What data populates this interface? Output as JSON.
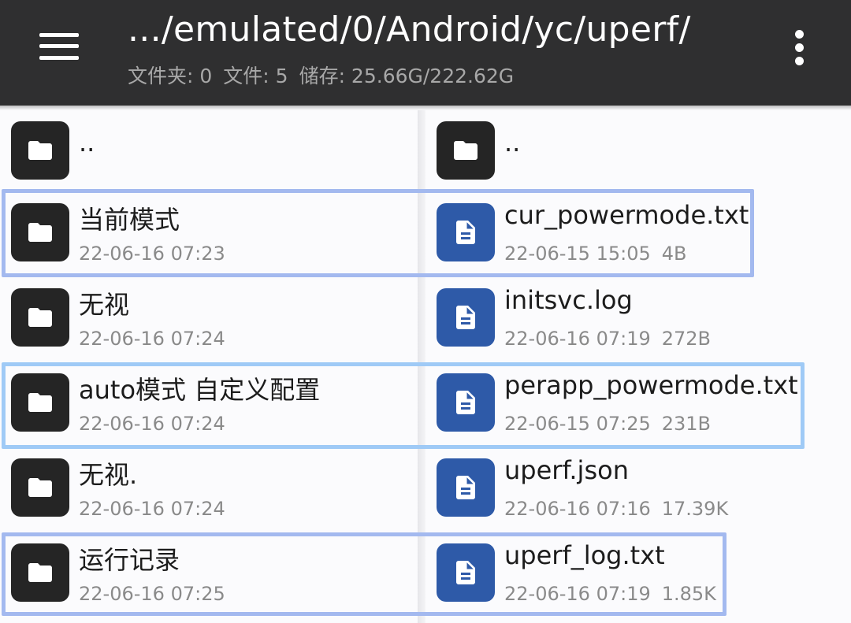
{
  "appbar": {
    "path": ".../emulated/0/Android/yc/uperf/",
    "folders_stat": "文件夹: 0",
    "files_stat": "文件: 5",
    "storage_stat": "储存: 25.66G/222.62G"
  },
  "left_pane": {
    "parent": {
      "name": ".."
    },
    "items": [
      {
        "name": "当前模式",
        "date": "22-06-16 07:23"
      },
      {
        "name": "无视",
        "date": "22-06-16 07:24"
      },
      {
        "name": "auto模式 自定义配置",
        "date": "22-06-16 07:24"
      },
      {
        "name": "无视.",
        "date": "22-06-16 07:24"
      },
      {
        "name": "运行记录",
        "date": "22-06-16 07:25"
      }
    ]
  },
  "right_pane": {
    "parent": {
      "name": ".."
    },
    "items": [
      {
        "name": "cur_powermode.txt",
        "date": "22-06-15 15:05",
        "size": "4B"
      },
      {
        "name": "initsvc.log",
        "date": "22-06-16 07:19",
        "size": "272B"
      },
      {
        "name": "perapp_powermode.txt",
        "date": "22-06-15 07:25",
        "size": "231B"
      },
      {
        "name": "uperf.json",
        "date": "22-06-16 07:16",
        "size": "17.39K"
      },
      {
        "name": "uperf_log.txt",
        "date": "22-06-16 07:19",
        "size": "1.85K"
      }
    ]
  },
  "icons": {
    "menu": "hamburger-menu-icon",
    "more": "more-vert-icon",
    "folder": "folder-icon",
    "file": "document-icon"
  },
  "colors": {
    "appbar_bg": "#2f2f30",
    "file_icon_bg": "#2e5aa8",
    "folder_icon_bg": "#252525",
    "highlight": "#a3b9ef",
    "highlight_light": "#9fcaf6"
  }
}
